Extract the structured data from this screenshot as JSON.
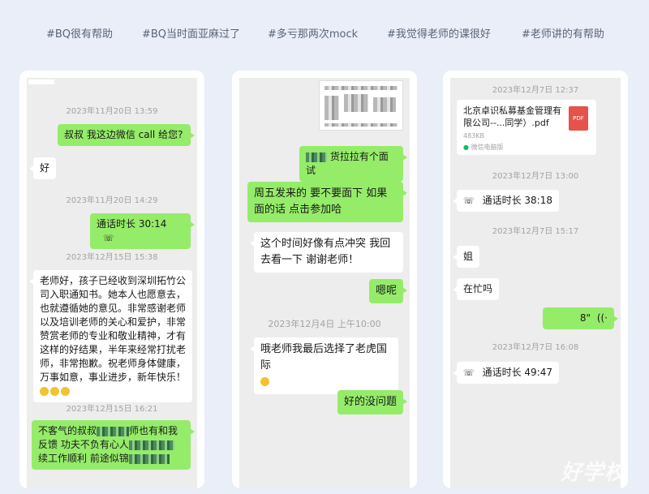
{
  "tags": [
    "#BQ很有帮助",
    "#BQ当时面亚麻过了",
    "#多亏那两次mock",
    "#我觉得老师的课很好",
    "#老师讲的有帮助"
  ],
  "chat1": {
    "ts1": "2023年11月20日 13:59",
    "m1": "叔叔 我这边微信 call 给您?",
    "m2": "好",
    "ts2": "2023年11月20日 14:29",
    "call1": "通话时长 30:14",
    "ts3": "2023年12月15日 15:38",
    "m3": "老师好，孩子已经收到深圳拓竹公司入职通知书。她本人也愿意去，也就遵循她的意见。非常感谢老师以及培训老师的关心和爱护，非常赞赏老师的专业和敬业精神，才有这样的好结果，半年来经常打扰老师，非常抱歉。祝老师身体健康，万事如意，事业进步，新年快乐！",
    "ts4": "2023年12月15日 16:21",
    "m4a": "不客气的叔叔",
    "m4b": "师也有和我",
    "m4c": "反馈 功夫不负有心人",
    "m4d": "续工作顺利 前途似锦"
  },
  "chat2": {
    "m1": "货拉拉有个面试",
    "m2": "周五发来的 要不要面下 如果面的话 点击参加哈",
    "m3": "这个时间好像有点冲突 我回去看一下 谢谢老师！",
    "m4": "嗯呢",
    "ts1": "2023年12月4日 上午10:00",
    "m5": "哦老师我最后选择了老虎国际",
    "m6": "好的没问题"
  },
  "chat3": {
    "ts1": "2023年12月7日 12:37",
    "file_name": "北京卓识私募基金管理有限公司--...同学）.pdf",
    "file_size": "483KB",
    "file_type": "PDF",
    "file_source": "微信电脑版",
    "ts2": "2023年12月7日 13:00",
    "call1": "通话时长 38:18",
    "ts3": "2023年12月7日 15:17",
    "m1": "姐",
    "m2": "在忙吗",
    "voice": "8\"",
    "ts4": "2023年12月7日 16:08",
    "call2": "通话时长 49:47"
  },
  "watermark": "好学校"
}
